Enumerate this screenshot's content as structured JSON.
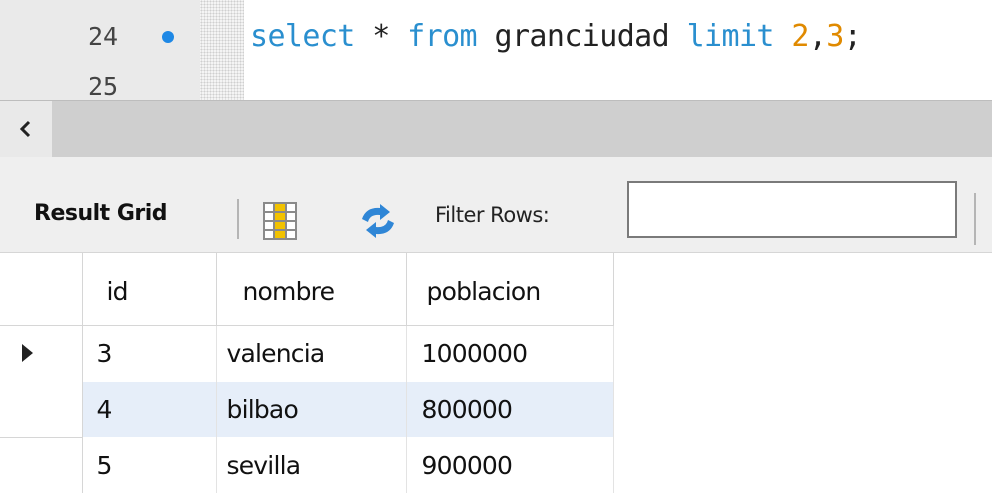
{
  "editor": {
    "lines": [
      {
        "number": "24",
        "has_marker": true,
        "tokens": [
          {
            "text": "select",
            "kind": "kw"
          },
          {
            "text": " * ",
            "kind": "id"
          },
          {
            "text": "from",
            "kind": "kw"
          },
          {
            "text": " granciudad ",
            "kind": "id"
          },
          {
            "text": "limit",
            "kind": "kw"
          },
          {
            "text": " ",
            "kind": "id"
          },
          {
            "text": "2",
            "kind": "num"
          },
          {
            "text": ",",
            "kind": "id"
          },
          {
            "text": "3",
            "kind": "num"
          },
          {
            "text": ";",
            "kind": "id"
          }
        ]
      },
      {
        "number": "25",
        "has_marker": false,
        "tokens": []
      }
    ],
    "colors": {
      "keyword": "#2a8fcf",
      "identifier": "#222222",
      "number": "#e08a00",
      "marker": "#1e88e5"
    }
  },
  "scrollbar": {
    "left_icon": "chevron-left-icon"
  },
  "toolbar": {
    "result_grid_label": "Result Grid",
    "grid_icon": "form-editor-icon",
    "refresh_icon": "refresh-icon",
    "filter_label": "Filter Rows:",
    "filter_value": ""
  },
  "result_grid": {
    "columns": [
      "id",
      "nombre",
      "poblacion"
    ],
    "rows": [
      {
        "id": "3",
        "nombre": "valencia",
        "poblacion": "1000000",
        "current": true
      },
      {
        "id": "4",
        "nombre": "bilbao",
        "poblacion": "800000",
        "selected": true
      },
      {
        "id": "5",
        "nombre": "sevilla",
        "poblacion": "900000"
      }
    ],
    "selected_row_color": "#e6eef9"
  }
}
